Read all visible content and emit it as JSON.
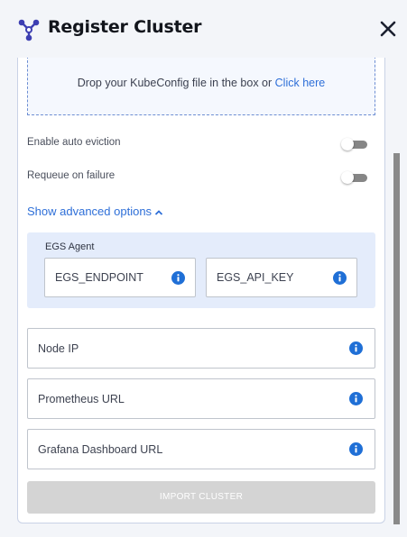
{
  "header": {
    "title": "Register Cluster"
  },
  "dropzone": {
    "text": "Drop your KubeConfig file in the box or",
    "link": "Click here"
  },
  "toggles": [
    {
      "label": "Enable auto eviction",
      "on": false
    },
    {
      "label": "Requeue on failure",
      "on": false
    }
  ],
  "advanced": {
    "label": "Show advanced options"
  },
  "egs": {
    "title": "EGS Agent",
    "endpoint_placeholder": "EGS_ENDPOINT",
    "api_key_placeholder": "EGS_API_KEY"
  },
  "fields": {
    "node_ip": "Node IP",
    "prometheus_url": "Prometheus URL",
    "grafana_url": "Grafana Dashboard URL"
  },
  "import_button": "IMPORT CLUSTER",
  "colors": {
    "accent": "#2e6fd8",
    "info_icon": "#1f6fd6",
    "logo": "#3d3fb2",
    "egs_bg": "#e4ecfb",
    "button_disabled": "#d4d4d4"
  },
  "icons": {
    "logo": "cluster-network-icon",
    "close": "close-icon",
    "info": "info-icon",
    "chevron": "chevron-up-icon"
  }
}
